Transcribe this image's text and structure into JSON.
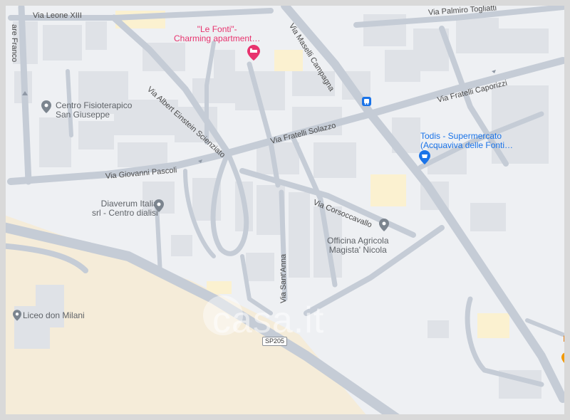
{
  "streets": {
    "via_leone_xiii": "Via Leone XIII",
    "via_palmiro_togliatti": "Via Palmiro Togliatti",
    "via_maselli_campagna": "Via Maselli Campagna",
    "via_fratelli_caporizzi": "Via Fratelli Caporizzi",
    "via_albert_einstein": "Via Albert Einstein Scienziato",
    "via_fratelli_solazzo": "Via Fratelli Solazzo",
    "via_giovanni_pascoli": "Via Giovanni Pascoli",
    "via_corsoccavallo": "Via Corsoccavallo",
    "via_sant_anna": "Via Sant'Anna",
    "via_franco_fragment": "are Franco"
  },
  "pois": {
    "le_fonti": "\"Le Fonti\"-\nCharming apartment…",
    "centro_fisioterapico": "Centro Fisioterapico\nSan Giuseppe",
    "todis": "Todis - Supermercato\n(Acquaviva delle Fonti…",
    "diaverum": "Diaverum Italia\nsrl - Centro dialisi",
    "officina_agricola": "Officina Agricola\nMagista' Nicola",
    "liceo": "Liceo don Milani",
    "edge_fragment_top": "Il",
    "edge_fragment_bottom": "P"
  },
  "road_shield": "SP205",
  "watermark": "casa.it",
  "colors": {
    "background": "#eef0f3",
    "road": "#c5ccd6",
    "road_outline": "#b3bcc8",
    "building": "#dfe2e7",
    "sand": "#f5ecd9",
    "highlight_area": "#fbf1d0",
    "poi_gray": "#5f6368",
    "poi_blue": "#1a73e8",
    "poi_pink": "#e8336e",
    "poi_orange": "#e37400"
  },
  "icons": {
    "le_fonti": "hotel-pin-icon",
    "centro_fisioterapico": "place-pin-icon",
    "todis": "shopping-pin-icon",
    "diaverum": "place-pin-icon",
    "officina_agricola": "place-pin-icon",
    "liceo": "place-pin-icon",
    "bus_stop": "bus-stop-icon",
    "edge_orange": "food-pin-icon"
  }
}
